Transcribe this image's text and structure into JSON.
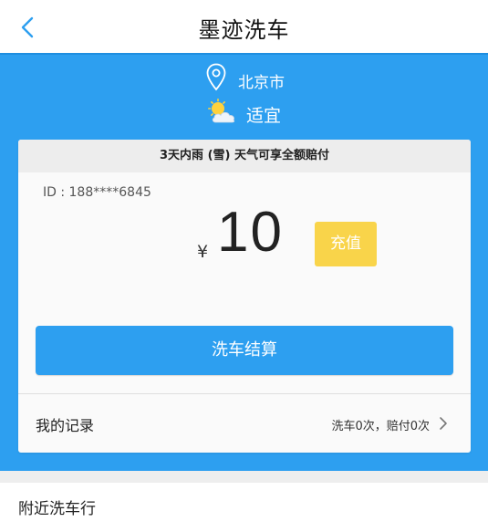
{
  "nav": {
    "title": "墨迹洗车",
    "back_icon": "chevron-left-icon"
  },
  "hero": {
    "location_icon": "map-pin-icon",
    "city": "北京市",
    "weather_icon": "sun-cloud-icon",
    "weather_status": "适宜"
  },
  "card": {
    "banner": "3天内雨 (雪) 天气可享全额赔付",
    "user_id": "ID : 188****6845",
    "currency_symbol": "¥",
    "balance": "10",
    "recharge_label": "充值",
    "checkout_label": "洗车结算",
    "records_label": "我的记录",
    "records_summary": "洗车0次，赔付0次"
  },
  "nearby": {
    "label": "附近洗车行"
  },
  "colors": {
    "primary_blue": "#2d9ff0",
    "recharge_yellow": "#f9d44a",
    "card_bg": "#fafafa",
    "banner_bg": "#ededed"
  }
}
